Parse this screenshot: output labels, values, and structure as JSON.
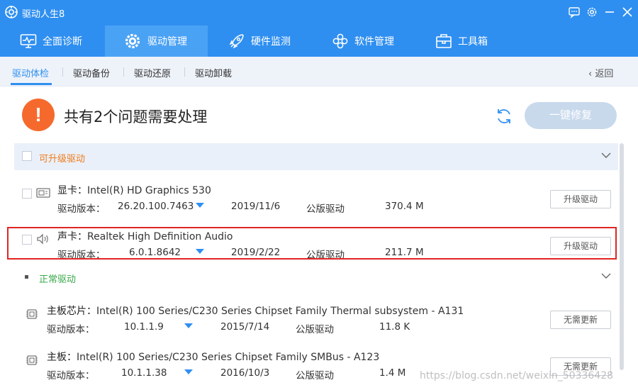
{
  "app": {
    "title": "驱动人生8"
  },
  "main_nav": [
    {
      "label": "全面诊断",
      "icon": "monitor-icon"
    },
    {
      "label": "驱动管理",
      "icon": "gear-icon"
    },
    {
      "label": "硬件监测",
      "icon": "rocket-icon"
    },
    {
      "label": "软件管理",
      "icon": "flower-apps-icon"
    },
    {
      "label": "工具箱",
      "icon": "toolbox-icon"
    }
  ],
  "sub_nav": {
    "items": [
      "驱动体检",
      "驱动备份",
      "驱动还原",
      "驱动卸载"
    ],
    "back": "返回"
  },
  "header": {
    "alert_symbol": "!",
    "headline": "共有2个问题需要处理",
    "fix_button": "一键修复"
  },
  "sections": {
    "upgrade": {
      "title": "可升级驱动"
    },
    "normal": {
      "title": "正常驱动"
    }
  },
  "labels": {
    "version": "驱动版本："
  },
  "drivers": [
    {
      "type": "显卡：",
      "name": "Intel(R) HD Graphics 530",
      "version": "26.20.100.7463",
      "date": "2019/11/6",
      "kind": "公版驱动",
      "size": "370.4 M",
      "action": "升级驱动"
    },
    {
      "type": "声卡：",
      "name": "Realtek High Definition Audio",
      "version": "6.0.1.8642",
      "date": "2019/2/22",
      "kind": "公版驱动",
      "size": "211.7 M",
      "action": "升级驱动"
    },
    {
      "type": "主板芯片：",
      "name": "Intel(R) 100 Series/C230 Series Chipset Family Thermal subsystem - A131",
      "version": "10.1.1.9",
      "date": "2015/7/14",
      "kind": "公版驱动",
      "size": "11.8 K",
      "action": "无需更新"
    },
    {
      "type": "主板：",
      "name": "Intel(R) 100 Series/C230 Series Chipset Family SMBus - A123",
      "version": "10.1.1.38",
      "date": "2016/10/3",
      "kind": "公版驱动",
      "size": "1.4 M",
      "action": "无需更新"
    }
  ],
  "watermark": "https://blog.csdn.net/weixin_50336428",
  "colors": {
    "primary": "#2f8ff0",
    "alert": "#f56a2c",
    "upgrade_title": "#f07b1b",
    "normal_title": "#39a94a",
    "highlight": "#e02424"
  }
}
